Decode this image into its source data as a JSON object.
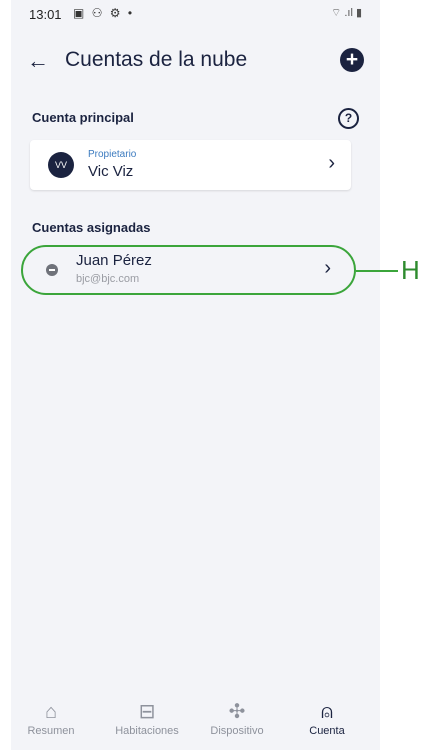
{
  "status_bar": {
    "time": "13:01",
    "icons": "▣ ⚇ ⚙ •",
    "right_icons": "⌔ .ıl ▮"
  },
  "app_bar": {
    "back_glyph": "←",
    "title": "Cuentas de la nube",
    "add_glyph": "+"
  },
  "main_account": {
    "section_title": "Cuenta principal",
    "help_glyph": "?",
    "avatar_initials": "VV",
    "role": "Propietario",
    "name": "Vic Viz",
    "chevron": "›"
  },
  "assigned_accounts": {
    "section_title": "Cuentas asignadas",
    "items": [
      {
        "name": "Juan Pérez",
        "email": "bjc@bjc.com",
        "chevron": "›"
      }
    ]
  },
  "annotation": {
    "label": "H",
    "color": "#3ba53b"
  },
  "bottom_nav": {
    "items": [
      {
        "label": "Resumen",
        "icon": "home-icon",
        "glyph": "⌂"
      },
      {
        "label": "Habitaciones",
        "icon": "sofa-icon",
        "glyph": "⊟"
      },
      {
        "label": "Dispositivo",
        "icon": "fan-icon",
        "glyph": "✣"
      },
      {
        "label": "Cuenta",
        "icon": "person-icon",
        "glyph": "⍝",
        "active": true
      }
    ]
  },
  "colors": {
    "primary": "#1b2340",
    "link": "#3c7bbf",
    "background": "#f3f4f8"
  }
}
